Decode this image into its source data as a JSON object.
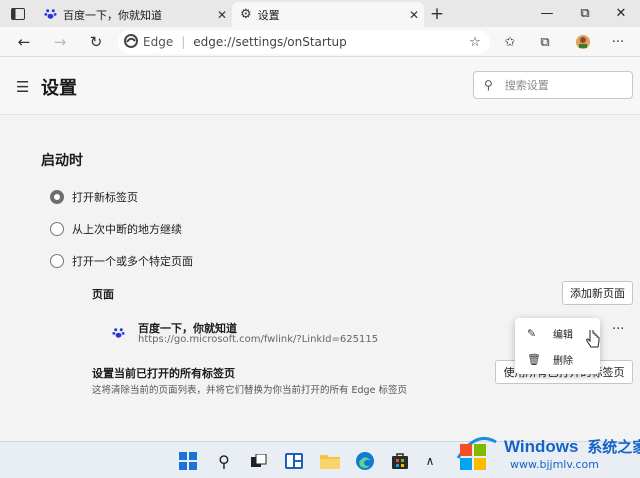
{
  "tabs": [
    {
      "title": "百度一下，你就知道",
      "close": "✕"
    },
    {
      "title": "设置",
      "close": "✕"
    }
  ],
  "new_tab": "+",
  "window": {
    "minimize": "—",
    "restore": "⧉",
    "close": "✕"
  },
  "address": {
    "brand": "Edge",
    "separator": "|",
    "url": "edge://settings/onStartup"
  },
  "header": {
    "title": "设置",
    "search_placeholder": "搜索设置"
  },
  "startup": {
    "heading": "启动时",
    "options": [
      {
        "label": "打开新标签页",
        "selected": true
      },
      {
        "label": "从上次中断的地方继续",
        "selected": false
      },
      {
        "label": "打开一个或多个特定页面",
        "selected": false
      }
    ],
    "pages_label": "页面",
    "add_page_button": "添加新页面",
    "page_entry": {
      "title": "百度一下，你就知道",
      "url": "https://go.microsoft.com/fwlink/?LinkId=625115",
      "more": "···"
    },
    "use_open_tabs": {
      "title": "设置当前已打开的所有标签页",
      "description": "这将清除当前的页面列表，并将它们替换为你当前打开的所有 Edge 标签页",
      "button": "使用所有已打开的标签页"
    }
  },
  "context_menu": {
    "edit": "编辑",
    "delete": "删除"
  },
  "watermark": {
    "brand": "Windows",
    "suffix": "系统之家",
    "site": "www.bjjmlv.com"
  },
  "colors": {
    "edge_accent": "#0f7bd6",
    "baidu_blue": "#2932e1",
    "watermark_blue": "#1463c8"
  }
}
